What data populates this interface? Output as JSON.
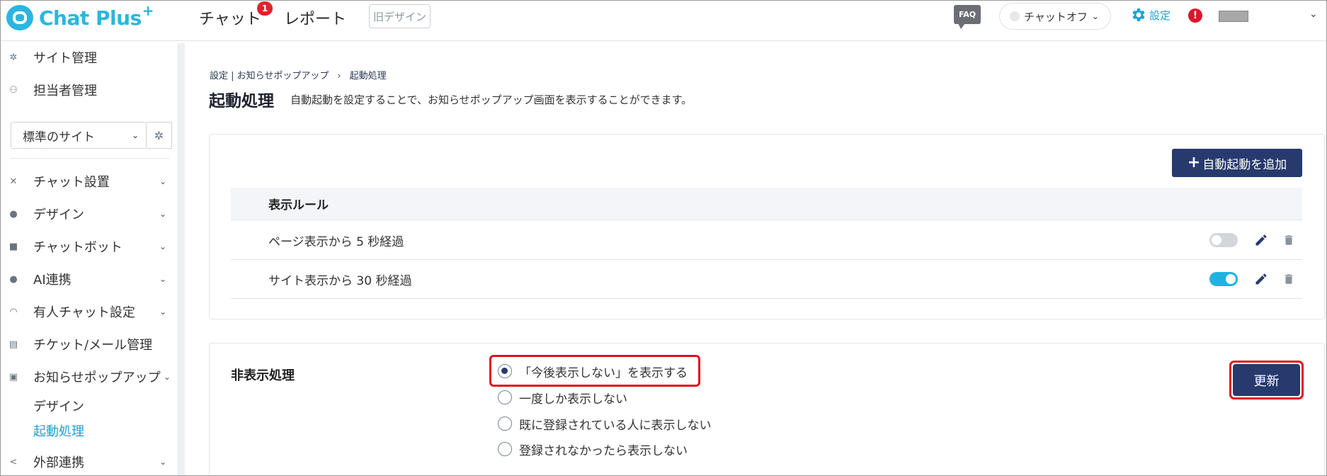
{
  "header": {
    "logo_text": "Chat Plus",
    "logo_plus": "+",
    "nav_chat": "チャット",
    "nav_chat_badge": "1",
    "nav_report": "レポート",
    "old_design": "旧デザイン",
    "faq": "FAQ",
    "status": "チャットオフ",
    "settings": "設定",
    "alert": "!"
  },
  "sidebar": {
    "top_items": [
      {
        "label": "サイト管理",
        "icon": "gear-icon"
      },
      {
        "label": "担当者管理",
        "icon": "people-icon"
      }
    ],
    "site_select": "標準のサイト",
    "items": [
      {
        "label": "チャット設置",
        "icon": "tools-icon"
      },
      {
        "label": "デザイン",
        "icon": "palette-icon"
      },
      {
        "label": "チャットボット",
        "icon": "chat-bubble-icon"
      },
      {
        "label": "AI連携",
        "icon": "bulb-icon"
      },
      {
        "label": "有人チャット設定",
        "icon": "headset-icon"
      },
      {
        "label": "チケット/メール管理",
        "icon": "ticket-icon"
      },
      {
        "label": "お知らせポップアップ",
        "icon": "popup-icon"
      }
    ],
    "sub_items": [
      {
        "label": "デザイン",
        "active": false
      },
      {
        "label": "起動処理",
        "active": true
      }
    ],
    "last_item": {
      "label": "外部連携",
      "icon": "share-icon"
    }
  },
  "breadcrumb": {
    "part1": "設定",
    "part2": "お知らせポップアップ",
    "current": "起動処理"
  },
  "page": {
    "title": "起動処理",
    "description": "自動起動を設定することで、お知らせポップアップ画面を表示することができます。"
  },
  "rules": {
    "add_button": "自動起動を追加",
    "column_header": "表示ルール",
    "rows": [
      {
        "label": "ページ表示から 5 秒経過",
        "enabled": false
      },
      {
        "label": "サイト表示から 30 秒経過",
        "enabled": true
      }
    ]
  },
  "hide_processing": {
    "label": "非表示処理",
    "options": [
      {
        "label": "「今後表示しない」を表示する",
        "checked": true
      },
      {
        "label": "一度しか表示しない",
        "checked": false
      },
      {
        "label": "既に登録されている人に表示しない",
        "checked": false
      },
      {
        "label": "登録されなかったら表示しない",
        "checked": false
      }
    ],
    "update_button": "更新"
  },
  "colors": {
    "brand": "#2bb6df",
    "primary": "#263a6e",
    "highlight": "#e0111e",
    "link": "#1da0d6"
  }
}
